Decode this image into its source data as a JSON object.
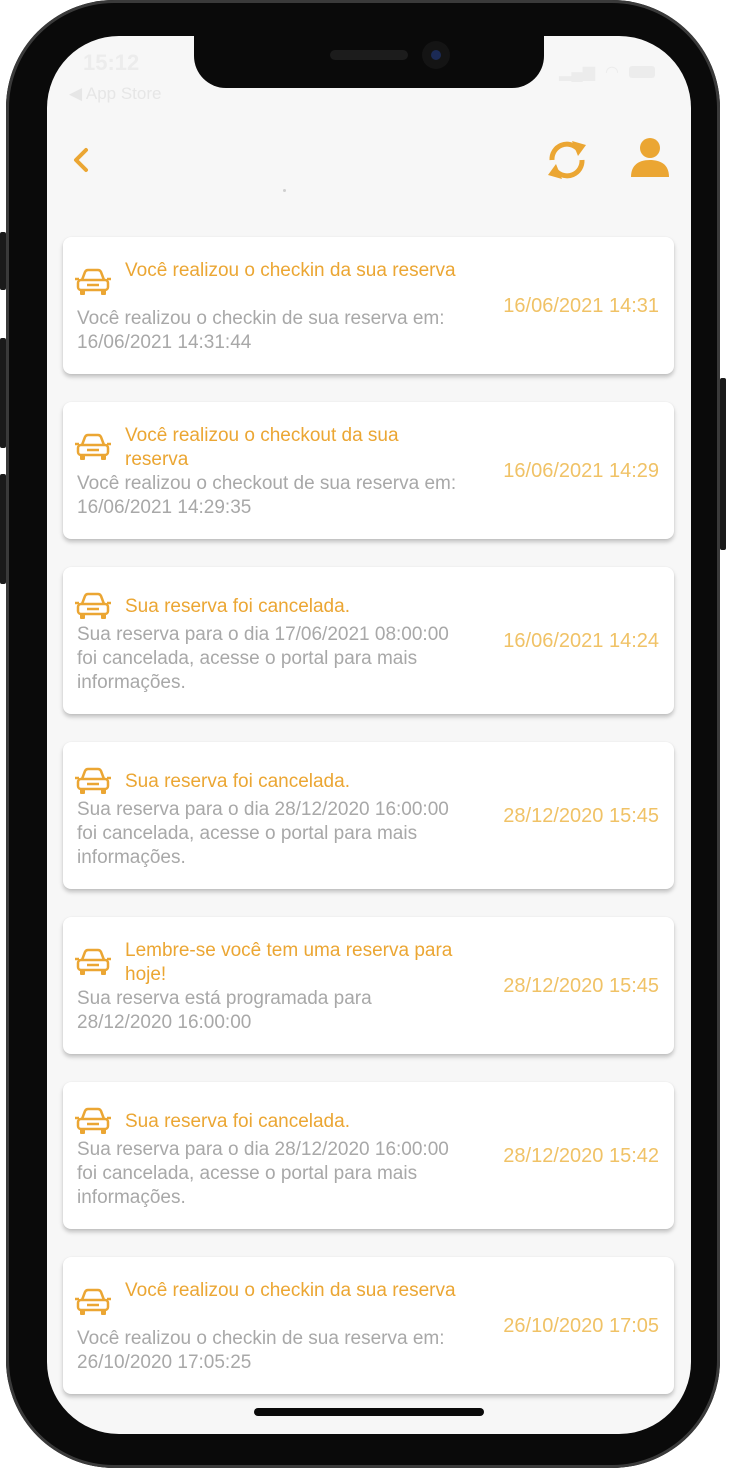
{
  "status_bar": {
    "time": "15:12",
    "back_app": "◀ App Store"
  },
  "colors": {
    "accent": "#eba633",
    "date": "#f0c266",
    "description": "#a8a8a8",
    "background": "#f7f7f7"
  },
  "header": {
    "back_icon": "chevron-left-icon",
    "sync_icon": "sync-icon",
    "user_icon": "user-icon"
  },
  "notifications": [
    {
      "icon": "car-icon",
      "title": "Você realizou o checkin da sua reserva",
      "description": "Você realizou o checkin de sua reserva em: 16/06/2021 14:31:44",
      "date": "16/06/2021 14:31"
    },
    {
      "icon": "car-icon",
      "title": "Você realizou o checkout da sua reserva",
      "description": "Você realizou o checkout de sua reserva em: 16/06/2021 14:29:35",
      "date": "16/06/2021 14:29"
    },
    {
      "icon": "car-icon",
      "title": "Sua reserva foi cancelada.",
      "description": "Sua reserva para o dia 17/06/2021 08:00:00 foi cancelada, acesse o portal para mais informações.",
      "date": "16/06/2021 14:24"
    },
    {
      "icon": "car-icon",
      "title": "Sua reserva foi cancelada.",
      "description": "Sua reserva para o dia 28/12/2020 16:00:00 foi cancelada, acesse o portal para mais informações.",
      "date": "28/12/2020 15:45"
    },
    {
      "icon": "car-icon",
      "title": "Lembre-se você tem uma reserva para hoje!",
      "description": "Sua reserva está programada para 28/12/2020 16:00:00",
      "date": "28/12/2020 15:45"
    },
    {
      "icon": "car-icon",
      "title": "Sua reserva foi cancelada.",
      "description": "Sua reserva para o dia 28/12/2020 16:00:00 foi cancelada, acesse o portal para mais informações.",
      "date": "28/12/2020 15:42"
    },
    {
      "icon": "car-icon",
      "title": "Você realizou o checkin da sua reserva",
      "description": "Você realizou o checkin de sua reserva em: 26/10/2020 17:05:25",
      "date": "26/10/2020 17:05"
    }
  ]
}
